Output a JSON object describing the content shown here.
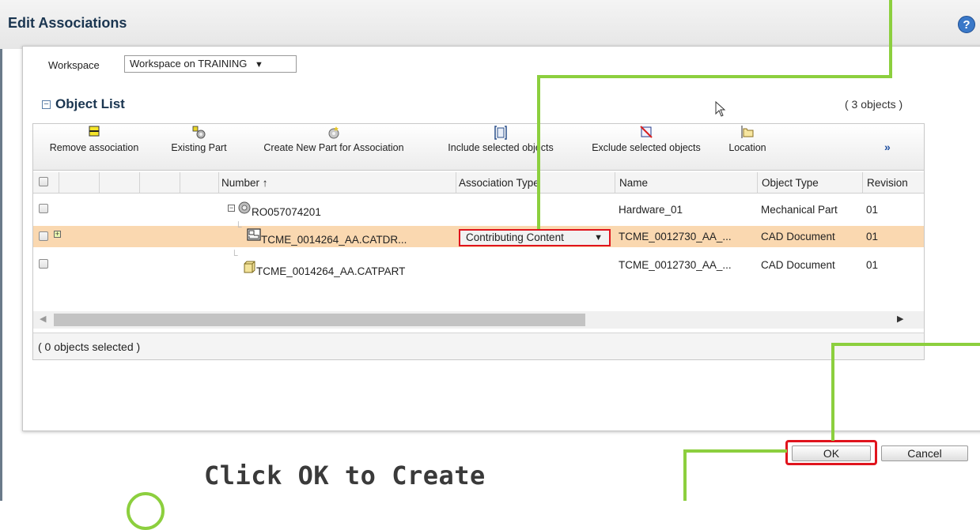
{
  "window": {
    "title": "Edit Associations",
    "help_icon": "help-icon",
    "help_glyph": "?"
  },
  "workspace": {
    "label": "Workspace",
    "selected": "Workspace on TRAINING",
    "arrow": "▼"
  },
  "object_list": {
    "toggle": "−",
    "title": "Object List",
    "count": "( 3 objects )"
  },
  "toolbar": {
    "items": [
      {
        "label": "Remove association",
        "icon": "remove-association-icon"
      },
      {
        "label": "Existing Part",
        "icon": "existing-part-icon"
      },
      {
        "label": "Create New Part for Association",
        "icon": "create-new-part-icon"
      },
      {
        "label": "Include selected objects",
        "icon": "include-objects-icon"
      },
      {
        "label": "Exclude selected objects",
        "icon": "exclude-objects-icon"
      },
      {
        "label": "Location",
        "icon": "location-folder-icon"
      }
    ],
    "more": "»"
  },
  "table": {
    "columns": [
      "Number ↑",
      "Association Type",
      "Name",
      "Object Type",
      "Revision"
    ],
    "rows": [
      {
        "number": "RO057074201",
        "association_type": "",
        "name": "Hardware_01",
        "object_type": "Mechanical Part",
        "revision": "01",
        "icon": "mechanical-part-icon"
      },
      {
        "number": "TCME_0014264_AA.CATDR...",
        "association_type": "Contributing Content",
        "name": "TCME_0012730_AA_...",
        "object_type": "CAD Document",
        "revision": "01",
        "icon": "cad-drawing-icon",
        "selected": true
      },
      {
        "number": "TCME_0014264_AA.CATPART",
        "association_type": "",
        "name": "TCME_0012730_AA_...",
        "object_type": "CAD Document",
        "revision": "01",
        "icon": "cad-part-icon"
      }
    ],
    "dropdown_arrow": "▼",
    "expand_plus": "+",
    "collapse_minus": "−"
  },
  "selection": {
    "count": "( 0 objects selected )"
  },
  "buttons": {
    "ok": "OK",
    "cancel": "Cancel"
  },
  "instruction": {
    "text": "Click OK to Create"
  },
  "colors": {
    "accent_green": "#8ccf3e",
    "highlight_red": "#e0141d",
    "selected_row": "#fad8b0",
    "title_blue": "#1a3550"
  }
}
